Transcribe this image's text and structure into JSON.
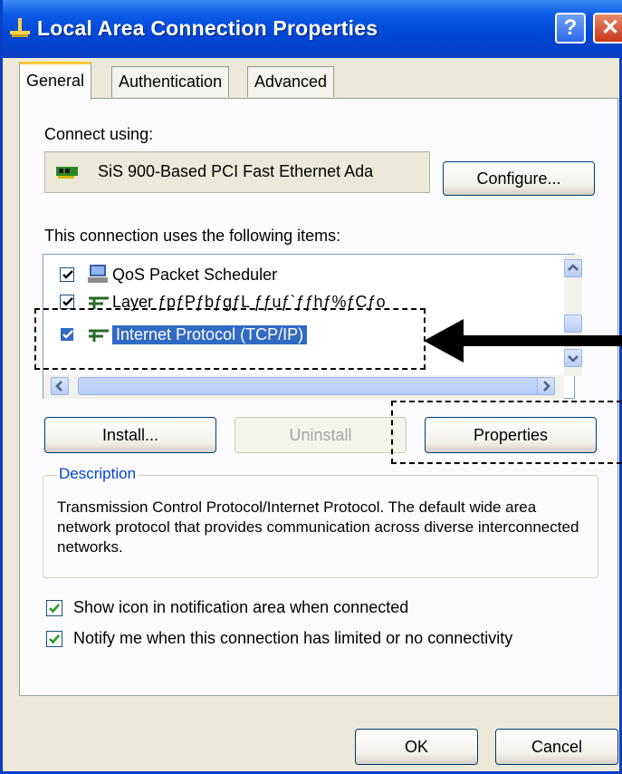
{
  "window": {
    "title": "Local Area Connection Properties",
    "help_label": "?",
    "close_label": "✕"
  },
  "tabs": [
    {
      "label": "General",
      "active": true
    },
    {
      "label": "Authentication",
      "active": false
    },
    {
      "label": "Advanced",
      "active": false
    }
  ],
  "general": {
    "connect_using_label": "Connect using:",
    "adapter_name": "SiS 900-Based PCI Fast Ethernet Ada",
    "configure_label": "Configure...",
    "items_label": "This connection uses the following items:",
    "items": [
      {
        "label": "QoS Packet Scheduler",
        "checked": true,
        "selected": false,
        "icon": "network-service-icon"
      },
      {
        "label": "Layer ƒpƒPƒbƒgƒL ƒƒuƒ`ƒƒhƒ%ƒCƒo",
        "checked": true,
        "selected": false,
        "icon": "protocol-icon"
      },
      {
        "label": "Internet Protocol (TCP/IP)",
        "checked": true,
        "selected": true,
        "icon": "protocol-icon"
      }
    ],
    "install_label": "Install...",
    "uninstall_label": "Uninstall",
    "properties_label": "Properties",
    "description_title": "Description",
    "description_text": "Transmission Control Protocol/Internet Protocol. The default wide area network protocol that provides communication across diverse interconnected networks.",
    "show_icon_label": "Show icon in notification area when connected",
    "show_icon_checked": true,
    "notify_label": "Notify me when this connection has limited or no connectivity",
    "notify_checked": true
  },
  "footer": {
    "ok_label": "OK",
    "cancel_label": "Cancel"
  },
  "colors": {
    "titlebar": "#0a3fc4",
    "selection": "#316ac5",
    "checkmark": "#21a121",
    "dialog_bg": "#ece9d8"
  }
}
